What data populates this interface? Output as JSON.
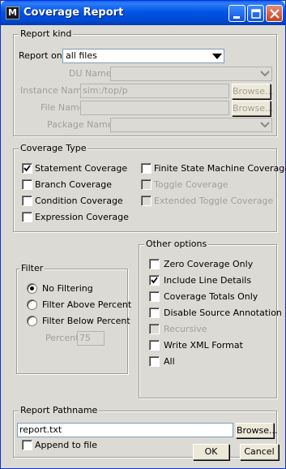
{
  "window": {
    "title": "Coverage Report",
    "app_icon_letter": "M"
  },
  "report_kind": {
    "legend": "Report kind",
    "report_on_label": "Report on",
    "report_on_value": "all files",
    "du_name_label": "DU Name",
    "du_name_value": "",
    "instance_name_label": "Instance Name",
    "instance_name_value": "sim:/top/p",
    "instance_browse": "Browse...",
    "file_name_label": "File Name",
    "file_name_value": "",
    "file_browse": "Browse...",
    "package_name_label": "Package Name",
    "package_name_value": ""
  },
  "coverage_type": {
    "legend": "Coverage Type",
    "items": [
      {
        "label": "Statement Coverage",
        "checked": true,
        "enabled": true
      },
      {
        "label": "Branch Coverage",
        "checked": false,
        "enabled": true
      },
      {
        "label": "Condition Coverage",
        "checked": false,
        "enabled": true
      },
      {
        "label": "Expression Coverage",
        "checked": false,
        "enabled": true
      },
      {
        "label": "Finite State Machine Coverage",
        "checked": false,
        "enabled": true
      },
      {
        "label": "Toggle Coverage",
        "checked": false,
        "enabled": false
      },
      {
        "label": "Extended Toggle Coverage",
        "checked": false,
        "enabled": false
      }
    ]
  },
  "filter": {
    "legend": "Filter",
    "options": [
      {
        "label": "No Filtering",
        "selected": true
      },
      {
        "label": "Filter Above Percent",
        "selected": false
      },
      {
        "label": "Filter Below Percent",
        "selected": false
      }
    ],
    "percent_label": "Percent",
    "percent_value": "75"
  },
  "other_options": {
    "legend": "Other options",
    "items": [
      {
        "label": "Zero Coverage Only",
        "checked": false,
        "enabled": true
      },
      {
        "label": "Include Line Details",
        "checked": true,
        "enabled": true
      },
      {
        "label": "Coverage Totals Only",
        "checked": false,
        "enabled": true
      },
      {
        "label": "Disable Source Annotation",
        "checked": false,
        "enabled": true
      },
      {
        "label": "Recursive",
        "checked": false,
        "enabled": false
      },
      {
        "label": "Write XML Format",
        "checked": false,
        "enabled": true
      },
      {
        "label": "All",
        "checked": false,
        "enabled": true
      }
    ]
  },
  "report_pathname": {
    "legend": "Report Pathname",
    "value": "report.txt",
    "browse": "Browse...",
    "append_label": "Append to file",
    "append_checked": false
  },
  "buttons": {
    "ok": "OK",
    "cancel": "Cancel"
  },
  "colors": {
    "titlebar": "#0055e5",
    "dialog_bg": "#dcdad5",
    "disabled_text": "#a09f9a"
  }
}
